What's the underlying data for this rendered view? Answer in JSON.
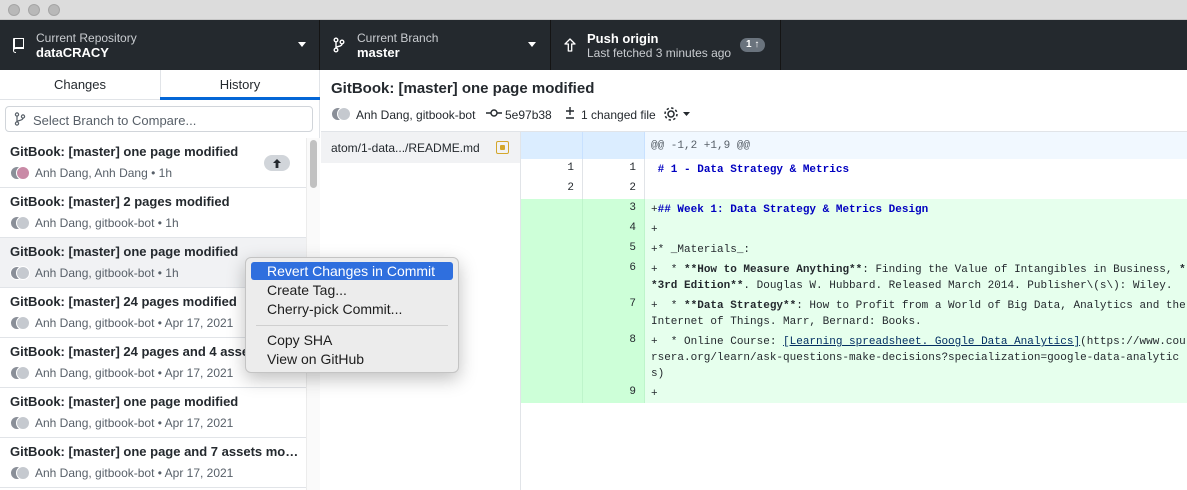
{
  "toolbar": {
    "repository": {
      "title": "Current Repository",
      "value": "dataCRACY"
    },
    "branch": {
      "title": "Current Branch",
      "value": "master"
    },
    "push": {
      "title": "Push origin",
      "subtitle": "Last fetched 3 minutes ago",
      "badge": "1 ↑"
    }
  },
  "sidebar": {
    "tabs": [
      "Changes",
      "History"
    ],
    "active_tab": "History",
    "branch_compare_placeholder": "Select Branch to Compare...",
    "commits": [
      {
        "title": "GitBook: [master] one page modified",
        "authors": "Anh Dang, Anh Dang",
        "time": "1h",
        "unpushed": true
      },
      {
        "title": "GitBook: [master] 2 pages modified",
        "authors": "Anh Dang, gitbook-bot",
        "time": "1h",
        "unpushed": false
      },
      {
        "title": "GitBook: [master] one page modified",
        "authors": "Anh Dang, gitbook-bot",
        "time": "1h",
        "unpushed": false,
        "selected": true
      },
      {
        "title": "GitBook: [master] 24 pages modified",
        "authors": "Anh Dang, gitbook-bot",
        "time": "Apr 17, 2021",
        "unpushed": false
      },
      {
        "title": "GitBook: [master] 24 pages and 4 assets modified",
        "authors": "Anh Dang, gitbook-bot",
        "time": "Apr 17, 2021",
        "unpushed": false
      },
      {
        "title": "GitBook: [master] one page modified",
        "authors": "Anh Dang, gitbook-bot",
        "time": "Apr 17, 2021",
        "unpushed": false
      },
      {
        "title": "GitBook: [master] one page and 7 assets mod...",
        "authors": "Anh Dang, gitbook-bot",
        "time": "Apr 17, 2021",
        "unpushed": false
      }
    ]
  },
  "commit": {
    "title": "GitBook: [master] one page modified",
    "authors": "Anh Dang, gitbook-bot",
    "sha": "5e97b38",
    "changed_files": "1 changed file"
  },
  "files": [
    {
      "name": "atom/1-data.../README.md",
      "status": "modified"
    }
  ],
  "diff": {
    "hunk_header": "@@ -1,2 +1,9 @@",
    "lines": [
      {
        "old": "1",
        "new": "1",
        "type": "context",
        "text": " # 1 - Data Strategy & Metrics"
      },
      {
        "old": "2",
        "new": "2",
        "type": "context",
        "text": ""
      },
      {
        "old": "",
        "new": "3",
        "type": "add",
        "text": "+## Week 1: Data Strategy & Metrics Design"
      },
      {
        "old": "",
        "new": "4",
        "type": "add",
        "text": "+"
      },
      {
        "old": "",
        "new": "5",
        "type": "add",
        "text": "+* _Materials_:"
      },
      {
        "old": "",
        "new": "6",
        "type": "add",
        "text": "+  * **How to Measure Anything**: Finding the Value of Intangibles in Business, **3rd Edition**. Douglas W. Hubbard. Released March 2014. Publisher\\(s\\): Wiley."
      },
      {
        "old": "",
        "new": "7",
        "type": "add",
        "text": "+  * **Data Strategy**: How to Profit from a World of Big Data, Analytics and the Internet of Things. Marr, Bernard: Books."
      },
      {
        "old": "",
        "new": "8",
        "type": "add",
        "text": "+  * Online Course: [Learning spreadsheet. Google Data Analytics](https://www.coursera.org/learn/ask-questions-make-decisions?specialization=google-data-analytics)"
      },
      {
        "old": "",
        "new": "9",
        "type": "add",
        "text": "+"
      }
    ]
  },
  "context_menu": {
    "items": [
      "Revert Changes in Commit",
      "Create Tag...",
      "Cherry-pick Commit...",
      "Copy SHA",
      "View on GitHub"
    ],
    "highlighted": "Revert Changes in Commit"
  },
  "colors": {
    "toolbar_bg": "#24292e",
    "accent": "#0366d6",
    "menu_highlight": "#2f6fde",
    "diff_add_bg": "#e6ffed",
    "diff_hunk_bg": "#f1f8ff"
  }
}
